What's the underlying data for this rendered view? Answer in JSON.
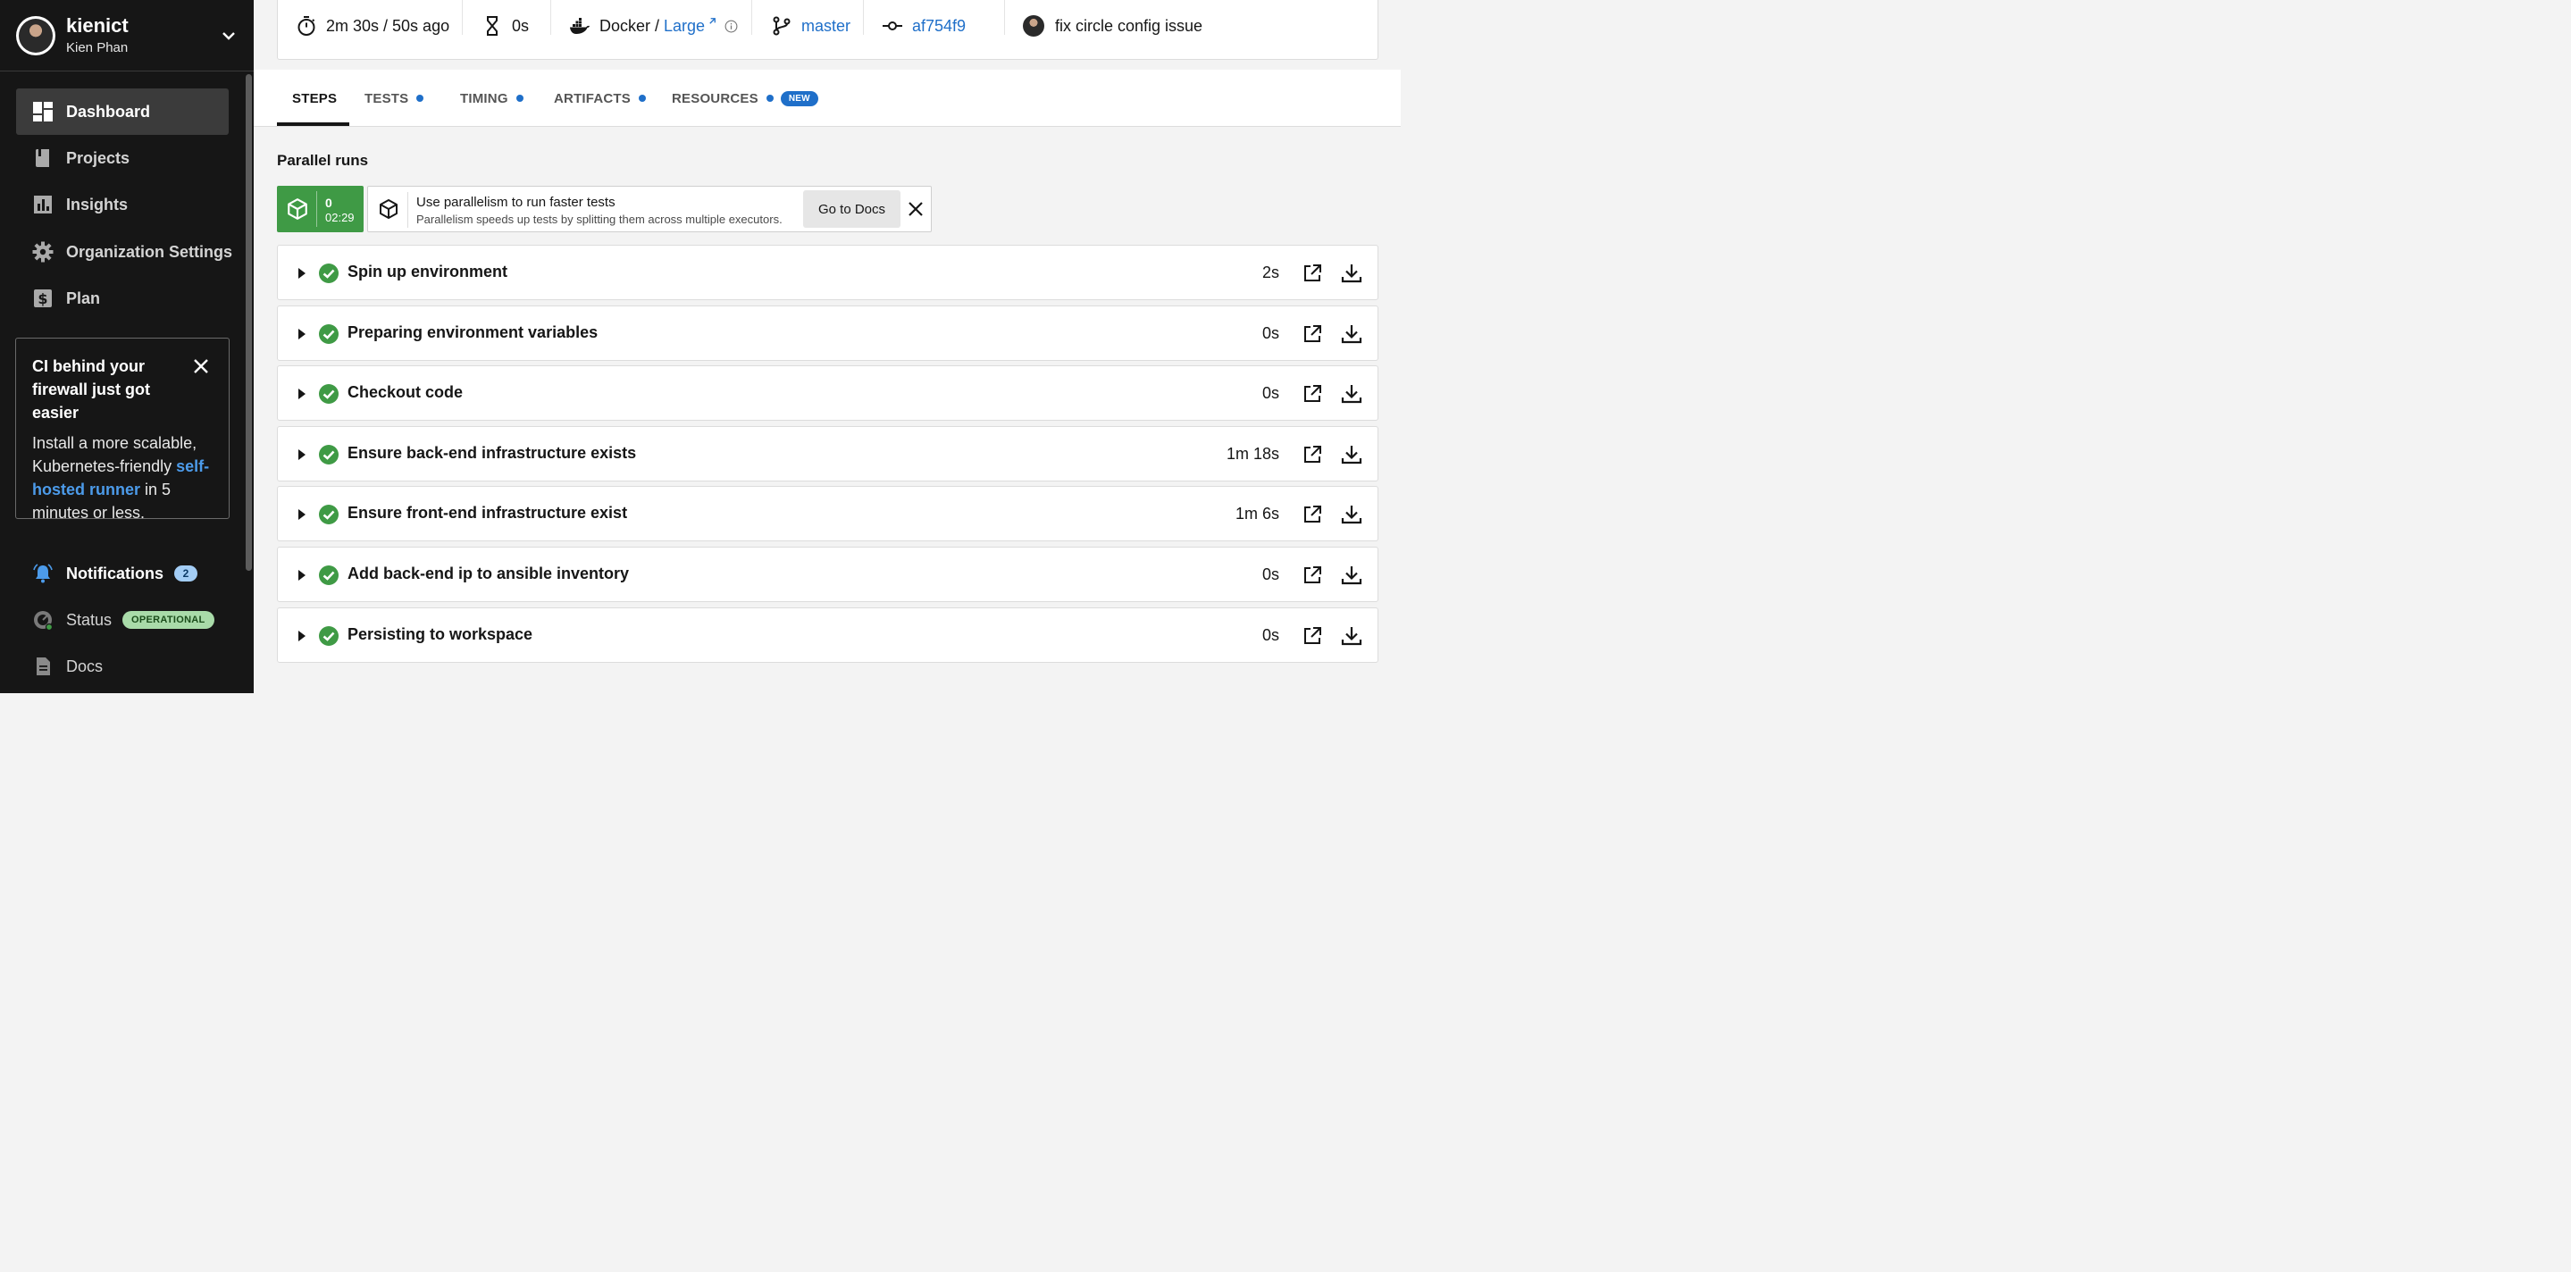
{
  "sidebar": {
    "user": {
      "login": "kienict",
      "name": "Kien Phan"
    },
    "nav": [
      {
        "label": "Dashboard",
        "icon": "dashboard-icon",
        "active": true
      },
      {
        "label": "Projects",
        "icon": "book-icon"
      },
      {
        "label": "Insights",
        "icon": "bar-chart-icon"
      },
      {
        "label": "Organization Settings",
        "icon": "gear-icon"
      },
      {
        "label": "Plan",
        "icon": "dollar-icon"
      }
    ],
    "promo": {
      "title": "CI behind your firewall just got easier",
      "body_start": "Install a more scalable, Kubernetes-friendly ",
      "link": "self-hosted runner",
      "body_end": " in 5 minutes or less."
    },
    "bottom": {
      "notifications_label": "Notifications",
      "notifications_count": "2",
      "status_label": "Status",
      "status_badge": "OPERATIONAL",
      "docs_label": "Docs"
    }
  },
  "job_meta": {
    "duration": "2m 30s / 50s ago",
    "queued": "0s",
    "executor_prefix": "Docker / ",
    "executor_link": "Large",
    "branch": "master",
    "commit": "af754f9",
    "commit_message": "fix circle config issue"
  },
  "tabs": [
    {
      "label": "STEPS",
      "active": true,
      "dot": false
    },
    {
      "label": "TESTS",
      "dot": true
    },
    {
      "label": "TIMING",
      "dot": true
    },
    {
      "label": "ARTIFACTS",
      "dot": true
    },
    {
      "label": "RESOURCES",
      "dot": true,
      "badge": "NEW"
    }
  ],
  "parallel": {
    "title": "Parallel runs",
    "run_index": "0",
    "run_time": "02:29",
    "banner_title": "Use parallelism to run faster tests",
    "banner_desc": "Parallelism speeds up tests by splitting them across multiple executors.",
    "docs_button": "Go to Docs"
  },
  "steps": [
    {
      "name": "Spin up environment",
      "duration": "2s"
    },
    {
      "name": "Preparing environment variables",
      "duration": "0s"
    },
    {
      "name": "Checkout code",
      "duration": "0s"
    },
    {
      "name": "Ensure back-end infrastructure exists",
      "duration": "1m 18s"
    },
    {
      "name": "Ensure front-end infrastructure exist",
      "duration": "1m 6s"
    },
    {
      "name": "Add back-end ip to ansible inventory",
      "duration": "0s"
    },
    {
      "name": "Persisting to workspace",
      "duration": "0s"
    }
  ],
  "colors": {
    "success": "#3f9a45",
    "link": "#1f6fc9",
    "sidebar_bg": "#161616"
  }
}
